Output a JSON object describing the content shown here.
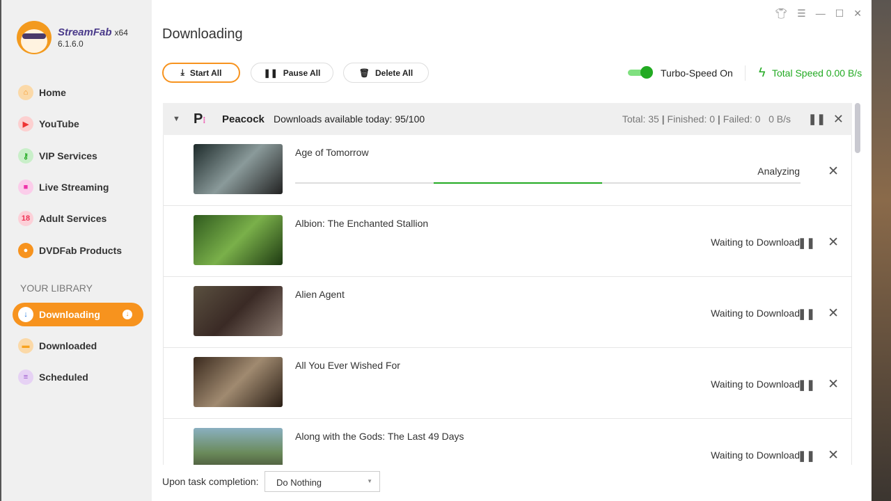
{
  "app": {
    "name": "StreamFab",
    "arch": "x64",
    "version": "6.1.6.0"
  },
  "sidebar": {
    "items": [
      {
        "label": "Home",
        "color": "#f7931e"
      },
      {
        "label": "YouTube",
        "color": "#ee3333"
      },
      {
        "label": "VIP Services",
        "color": "#33bb44"
      },
      {
        "label": "Live Streaming",
        "color": "#ee33aa"
      },
      {
        "label": "Adult Services",
        "color": "#ee3355"
      },
      {
        "label": "DVDFab Products",
        "color": "#2277dd"
      }
    ],
    "library_heading": "YOUR LIBRARY",
    "library": [
      {
        "label": "Downloading",
        "active": true
      },
      {
        "label": "Downloaded",
        "color": "#f7a21e"
      },
      {
        "label": "Scheduled",
        "color": "#9955cc"
      }
    ]
  },
  "page": {
    "title": "Downloading"
  },
  "toolbar": {
    "start_all": "Start All",
    "pause_all": "Pause All",
    "delete_all": "Delete All",
    "turbo": "Turbo-Speed On",
    "turbo_on": true,
    "total_speed": "Total Speed 0.00 B/s"
  },
  "group": {
    "service": "Peacock",
    "available": "Downloads available today: 95/100",
    "total": "Total: 35",
    "finished": "Finished: 0",
    "failed": "Failed: 0",
    "speed": "0 B/s"
  },
  "items": [
    {
      "title": "Age of Tomorrow",
      "status": "Analyzing"
    },
    {
      "title": "Albion: The Enchanted Stallion",
      "status": "Waiting to Download"
    },
    {
      "title": "Alien Agent",
      "status": "Waiting to Download"
    },
    {
      "title": "All You Ever Wished For",
      "status": "Waiting to Download"
    },
    {
      "title": "Along with the Gods: The Last 49 Days",
      "status": "Waiting to Download"
    }
  ],
  "footer": {
    "label": "Upon task completion:",
    "option": "Do Nothing"
  }
}
